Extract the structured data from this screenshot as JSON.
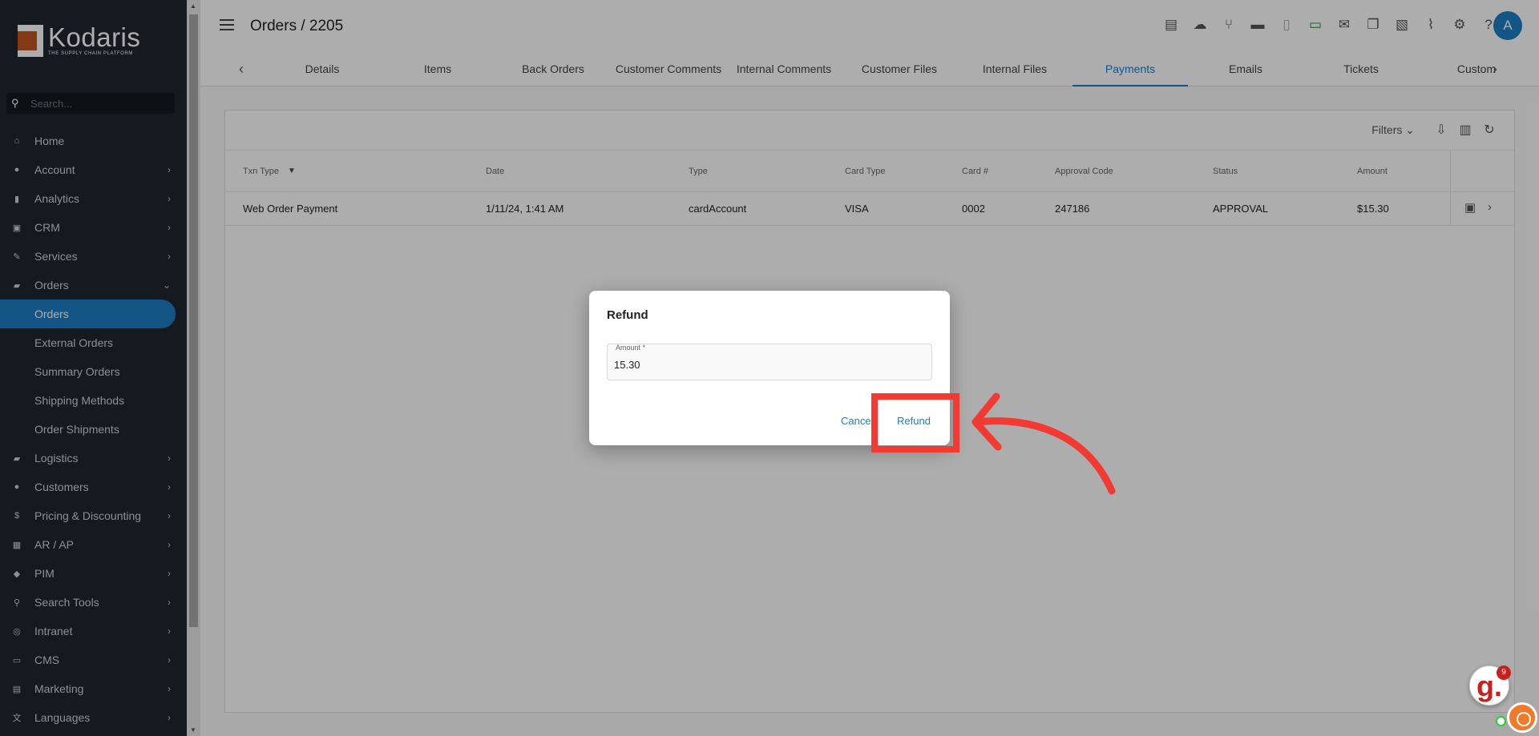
{
  "brand": {
    "name": "Kodaris",
    "tagline": "THE SUPPLY CHAIN PLATFORM"
  },
  "sidebar": {
    "search_placeholder": "Search...",
    "items": [
      {
        "label": "Home",
        "icon": "home-icon",
        "glyph": "⌂",
        "chevron": ""
      },
      {
        "label": "Account",
        "icon": "account-icon",
        "glyph": "●",
        "chevron": "›"
      },
      {
        "label": "Analytics",
        "icon": "analytics-icon",
        "glyph": "▮",
        "chevron": "›"
      },
      {
        "label": "CRM",
        "icon": "crm-icon",
        "glyph": "▣",
        "chevron": "›"
      },
      {
        "label": "Services",
        "icon": "services-icon",
        "glyph": "✎",
        "chevron": "›"
      },
      {
        "label": "Orders",
        "icon": "truck-icon",
        "glyph": "▰",
        "chevron": "⌄"
      },
      {
        "label": "Orders",
        "sub": true,
        "active": true
      },
      {
        "label": "External Orders",
        "sub": true
      },
      {
        "label": "Summary Orders",
        "sub": true
      },
      {
        "label": "Shipping Methods",
        "sub": true
      },
      {
        "label": "Order Shipments",
        "sub": true
      },
      {
        "label": "Logistics",
        "icon": "logistics-icon",
        "glyph": "▰",
        "chevron": "›"
      },
      {
        "label": "Customers",
        "icon": "customers-icon",
        "glyph": "●",
        "chevron": "›"
      },
      {
        "label": "Pricing & Discounting",
        "icon": "dollar-icon",
        "glyph": "$",
        "chevron": "›"
      },
      {
        "label": "AR / AP",
        "icon": "bank-icon",
        "glyph": "▦",
        "chevron": "›"
      },
      {
        "label": "PIM",
        "icon": "tag-icon",
        "glyph": "◆",
        "chevron": "›"
      },
      {
        "label": "Search Tools",
        "icon": "search-tools-icon",
        "glyph": "⚲",
        "chevron": "›"
      },
      {
        "label": "Intranet",
        "icon": "intranet-icon",
        "glyph": "◎",
        "chevron": "›"
      },
      {
        "label": "CMS",
        "icon": "cms-icon",
        "glyph": "▭",
        "chevron": "›"
      },
      {
        "label": "Marketing",
        "icon": "marketing-icon",
        "glyph": "▤",
        "chevron": "›"
      },
      {
        "label": "Languages",
        "icon": "translate-icon",
        "glyph": "文",
        "chevron": "›"
      }
    ]
  },
  "header": {
    "title": "Orders / 2205",
    "avatar_initial": "A",
    "icons": [
      "calendar-icon",
      "cloud-upload-icon",
      "merge-icon",
      "archive-icon",
      "receipt-icon",
      "credit-card-icon",
      "mail-icon",
      "copy-icon",
      "note-add-icon",
      "attachment-icon",
      "settings-icon",
      "help-icon"
    ]
  },
  "tabs": {
    "items": [
      "Details",
      "Items",
      "Back Orders",
      "Customer Comments",
      "Internal Comments",
      "Customer Files",
      "Internal Files",
      "Payments",
      "Emails",
      "Tickets",
      "Custom"
    ],
    "active": "Payments"
  },
  "grid": {
    "filters_label": "Filters",
    "columns": [
      "Txn Type",
      "Date",
      "Type",
      "Card Type",
      "Card #",
      "Approval Code",
      "Status",
      "Amount"
    ],
    "rows": [
      [
        "Web Order Payment",
        "1/11/24, 1:41 AM",
        "cardAccount",
        "VISA",
        "0002",
        "247186",
        "APPROVAL",
        "$15.30"
      ]
    ]
  },
  "dialog": {
    "title": "Refund",
    "amount_label": "Amount *",
    "amount_value": "15.30",
    "cancel_label": "Cancel",
    "refund_label": "Refund"
  },
  "chat": {
    "badge_count": "9",
    "logo_letter": "g."
  },
  "colors": {
    "accent": "#1d7fc4",
    "sidebar_bg": "#1f2630",
    "annotation": "#f23a32"
  }
}
